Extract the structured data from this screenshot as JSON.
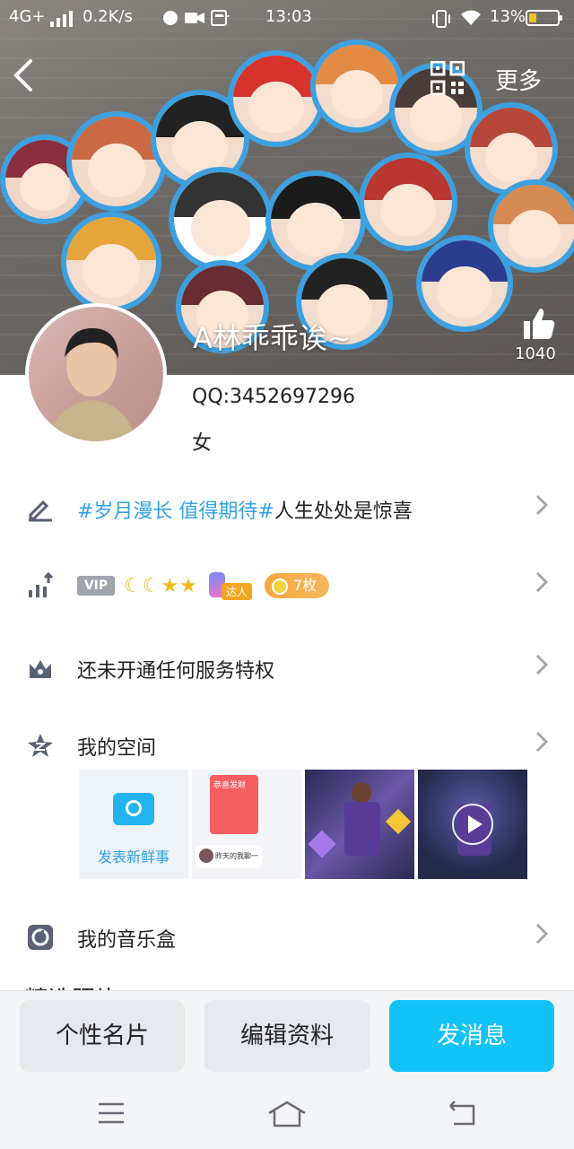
{
  "status_bar": {
    "network": "4G+",
    "speed": "0.2K/s",
    "dots": "···",
    "time": "13:03",
    "battery": "13%"
  },
  "header": {
    "more_label": "更多",
    "back_icon": "back-chevron-icon",
    "qr_icon": "qr-code-icon"
  },
  "profile": {
    "nickname": "A林乖乖诶~",
    "like_count": "1040",
    "qq": "QQ:3452697296",
    "gender": "女"
  },
  "rows": {
    "signature": {
      "tags": "#岁月漫长 值得期待#",
      "text": "人生处处是惊喜"
    },
    "level": {
      "vip": "VIP",
      "daren": "达人",
      "coins": "7枚"
    },
    "privilege": {
      "text": "还未开通任何服务特权"
    },
    "space": {
      "title": "我的空间",
      "post_label": "发表新鲜事",
      "thumb_card_text": "恭喜发财",
      "thumb_msg_text": "昨天的我聊一"
    },
    "music": {
      "title": "我的音乐盒"
    }
  },
  "peek_section": "精选照片",
  "actions": {
    "card": "个性名片",
    "edit": "编辑资料",
    "message": "发消息"
  },
  "colors": {
    "accent": "#12c3f8",
    "tag_blue": "#2fa1e6",
    "coin_orange": "#f6a63d"
  }
}
